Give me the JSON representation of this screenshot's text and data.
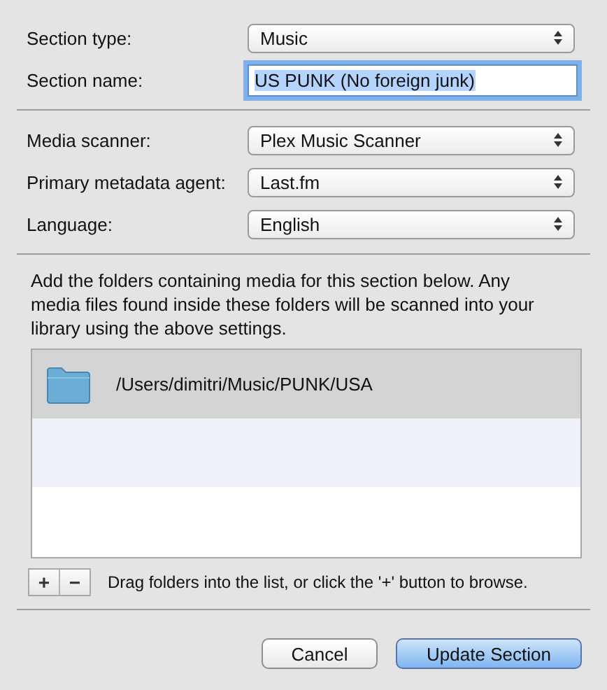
{
  "general": [
    {
      "kind": "popup",
      "label": "Section type:",
      "value": "Music"
    },
    {
      "kind": "text",
      "label": "Section name:",
      "value": "US PUNK (No foreign junk)",
      "focused": true
    }
  ],
  "agents": [
    {
      "kind": "popup",
      "label": "Media scanner:",
      "value": "Plex Music Scanner"
    },
    {
      "kind": "popup",
      "label": "Primary metadata agent:",
      "value": "Last.fm"
    },
    {
      "kind": "popup",
      "label": "Language:",
      "value": "English"
    }
  ],
  "instructions": "Add the folders containing media for this section below. Any media files found inside these folders will be scanned into your library using the above settings.",
  "folders": [
    {
      "path": "/Users/dimitri/Music/PUNK/USA",
      "selected": true
    }
  ],
  "list_buttons": [
    "+",
    "−"
  ],
  "list_hint": "Drag folders into the list, or click the '+' button to browse.",
  "buttons": [
    {
      "label": "Cancel",
      "default": false
    },
    {
      "label": "Update Section",
      "default": true
    }
  ]
}
